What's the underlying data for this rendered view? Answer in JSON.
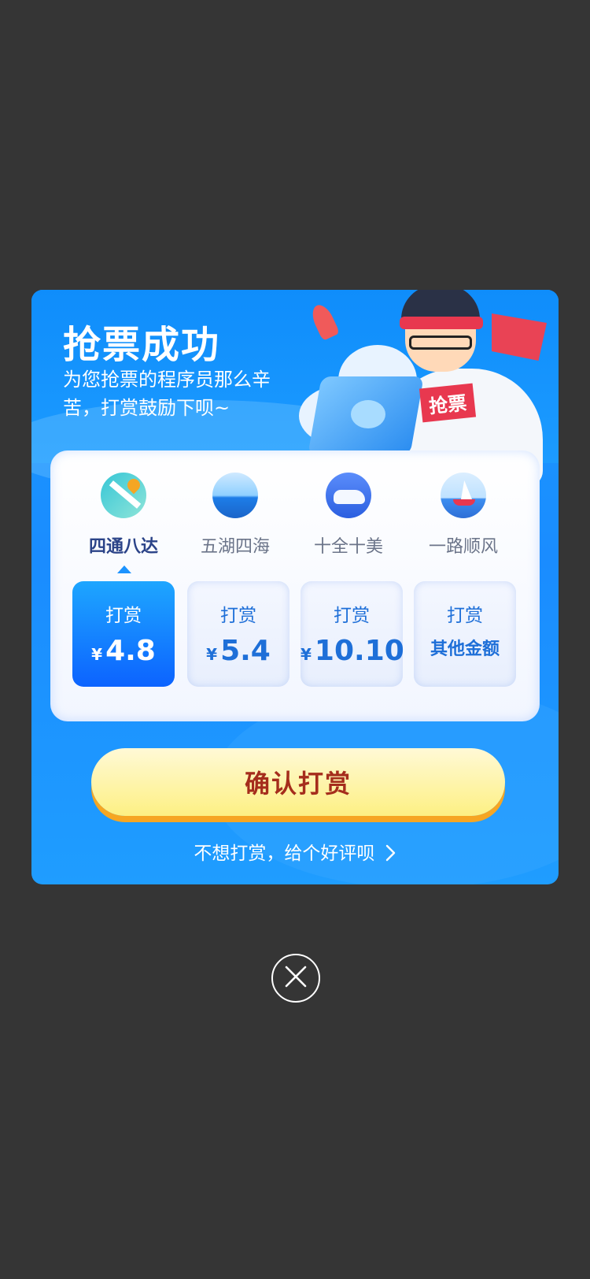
{
  "dialog": {
    "title": "抢票成功",
    "subtitle": "为您抢票的程序员那么辛苦，打赏鼓励下呗~",
    "illustration_tag": "抢票"
  },
  "themes": [
    {
      "label": "四通八达",
      "icon": "map-pin-icon",
      "selected": true
    },
    {
      "label": "五湖四海",
      "icon": "sea-horizon-icon",
      "selected": false
    },
    {
      "label": "十全十美",
      "icon": "bullet-train-icon",
      "selected": false
    },
    {
      "label": "一路顺风",
      "icon": "sailboat-icon",
      "selected": false
    }
  ],
  "amounts": [
    {
      "label": "打赏",
      "currency": "¥",
      "value": "4.8",
      "selected": true
    },
    {
      "label": "打赏",
      "currency": "¥",
      "value": "5.4",
      "selected": false
    },
    {
      "label": "打赏",
      "currency": "¥",
      "value": "10.10",
      "selected": false
    },
    {
      "label": "打赏",
      "value": "其他金额",
      "selected": false
    }
  ],
  "confirm_button": "确认打赏",
  "review_link": "不想打赏，给个好评呗",
  "colors": {
    "overlay": "#353535",
    "primary": "#1a8cff",
    "accent_text": "#a52d1c",
    "button_bg": "#fdf083"
  }
}
